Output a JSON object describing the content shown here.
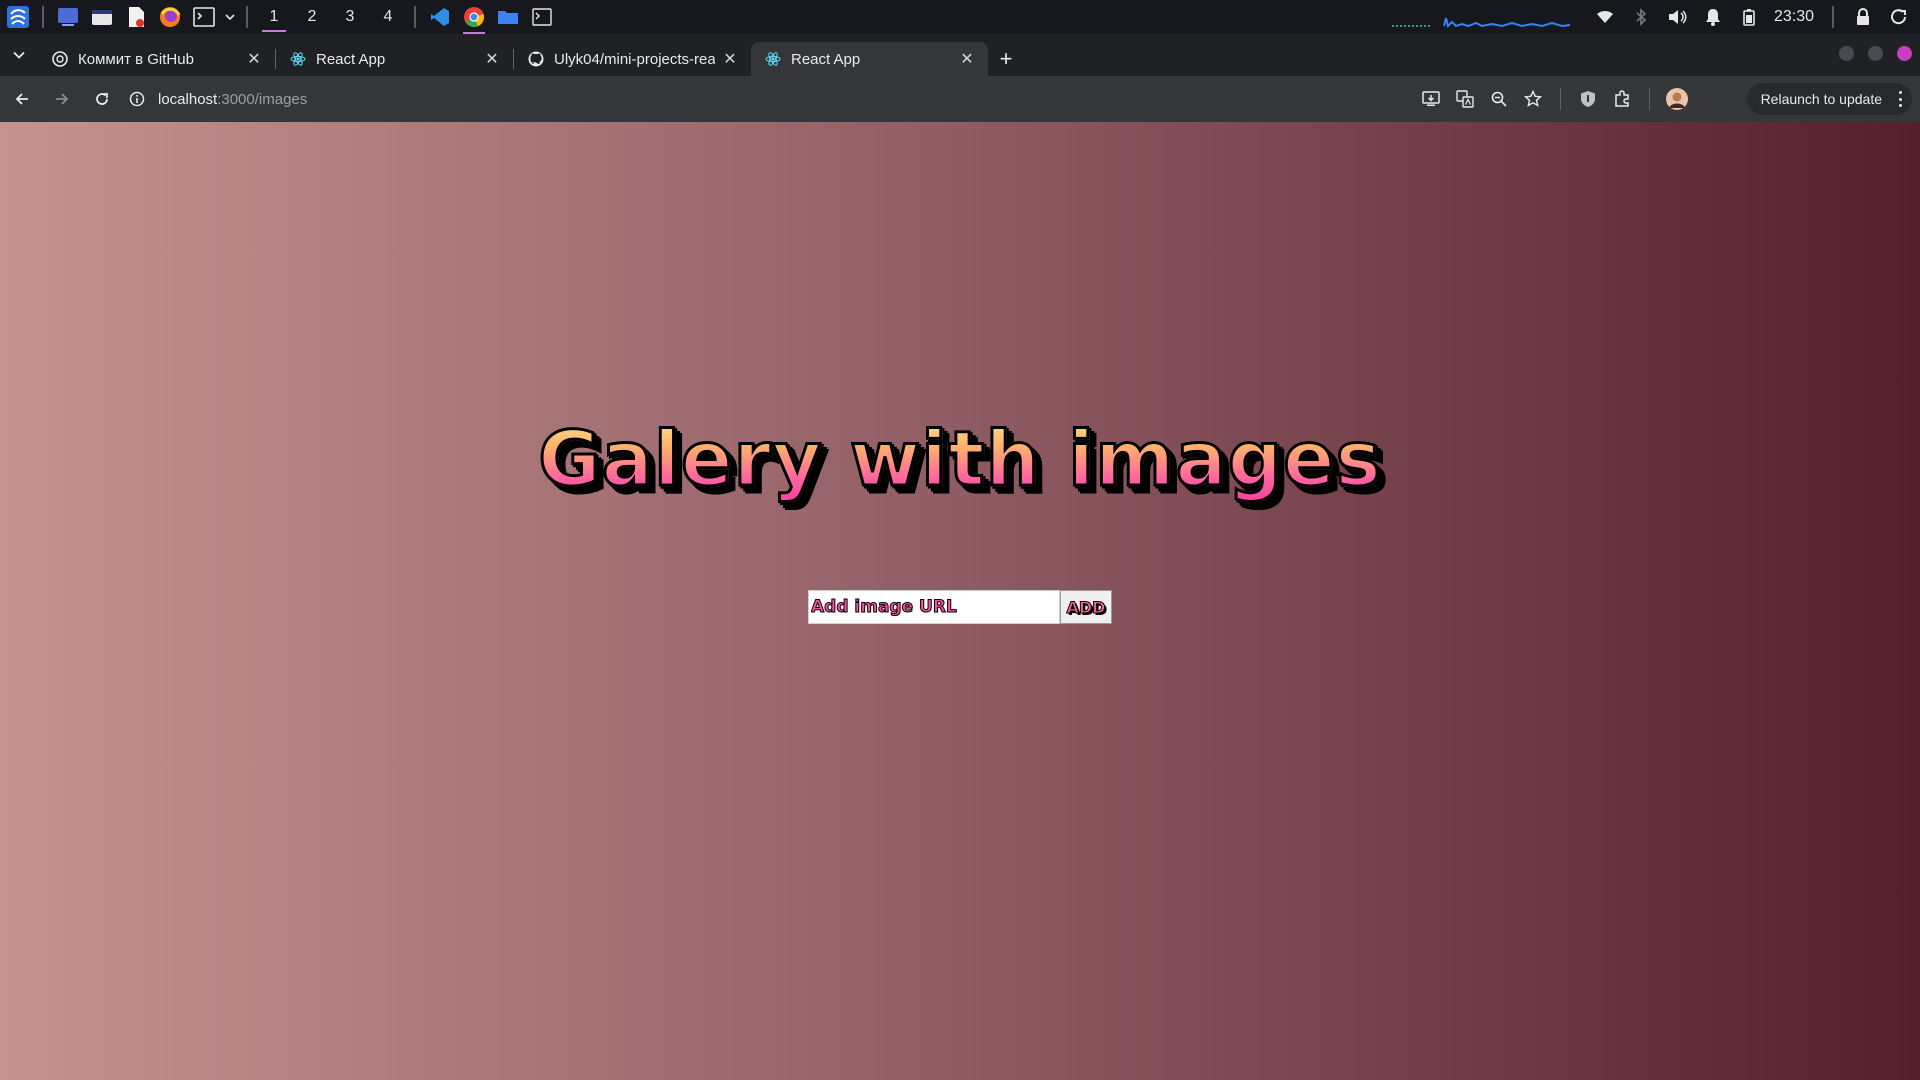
{
  "os_panel": {
    "workspaces": [
      "1",
      "2",
      "3",
      "4"
    ],
    "active_workspace": "1",
    "clock": "23:30",
    "apps": [
      "launcher-icon",
      "desktop-icon",
      "files-icon",
      "text-editor-icon",
      "firefox-icon",
      "terminal-icon",
      "vscode-icon",
      "chrome-icon",
      "folder-icon",
      "terminal-window-icon"
    ],
    "tray_icons": [
      "wifi-icon",
      "bluetooth-icon",
      "volume-icon",
      "bell-icon",
      "battery-icon",
      "lock-icon",
      "power-icon"
    ]
  },
  "tabs": [
    {
      "title": "Коммит в GitHub",
      "favicon": "chatgpt-icon",
      "active": false
    },
    {
      "title": "React App",
      "favicon": "react-icon",
      "active": false
    },
    {
      "title": "Ulyk04/mini-projects-react",
      "favicon": "github-icon",
      "active": false
    },
    {
      "title": "React App",
      "favicon": "react-icon",
      "active": true
    }
  ],
  "toolbar": {
    "url_host": "localhost",
    "url_path": ":3000/images",
    "relaunch_label": "Relaunch to update"
  },
  "page": {
    "heading": "Galery with images",
    "input_placeholder": "Add image URL",
    "add_button_label": "ADD"
  },
  "colors": {
    "page_gradient_start": "#c4928f",
    "page_gradient_end": "#54202b",
    "heading_top": "#ffe89a",
    "heading_bottom": "#ff3f9a",
    "accent": "#c678dd"
  }
}
